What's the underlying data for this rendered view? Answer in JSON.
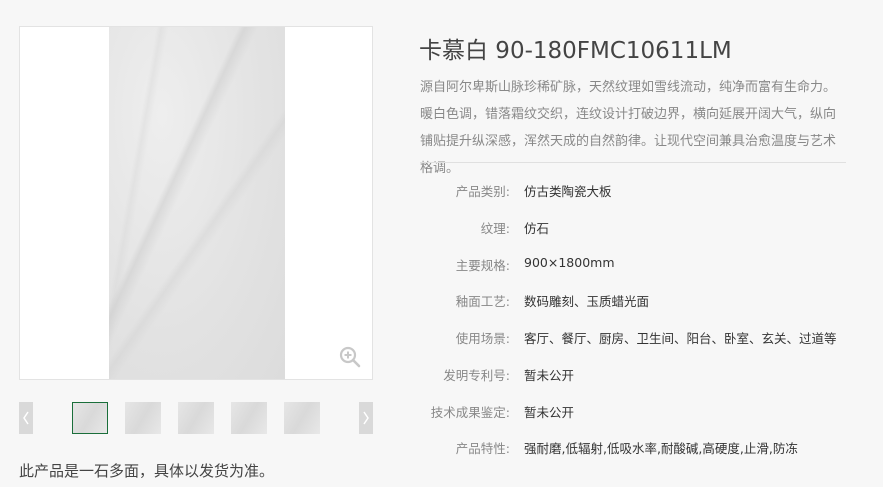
{
  "product": {
    "title": "卡慕白 90-180FMC10611LM",
    "description": "源自阿尔卑斯山脉珍稀矿脉，天然纹理如雪线流动，纯净而富有生命力。暖白色调，错落霜纹交织，连纹设计打破边界，横向延展开阔大气，纵向铺贴提升纵深感，浑然天成的自然韵律。让现代空间兼具治愈温度与艺术格调。"
  },
  "specs": [
    {
      "label": "产品类别:",
      "value": "仿古类陶瓷大板"
    },
    {
      "label": "纹理:",
      "value": "仿石"
    },
    {
      "label": "主要规格:",
      "value": "900×1800mm"
    },
    {
      "label": "釉面工艺:",
      "value": "数码雕刻、玉质蜡光面"
    },
    {
      "label": "使用场景:",
      "value": "客厅、餐厅、厨房、卫生间、阳台、卧室、玄关、过道等"
    },
    {
      "label": "发明专利号:",
      "value": "暂未公开"
    },
    {
      "label": "技术成果鉴定:",
      "value": "暂未公开"
    },
    {
      "label": "产品特性:",
      "value": "强耐磨,低辐射,低吸水率,耐酸碱,高硬度,止滑,防冻"
    }
  ],
  "gallery": {
    "note": "此产品是一石多面，具体以发货为准。",
    "thumbnail_count": 5,
    "active_thumbnail": 0,
    "icons": {
      "zoom": "zoom-in-icon",
      "prev": "chevron-left-icon",
      "next": "chevron-right-icon"
    }
  },
  "colors": {
    "accent": "#1a6e3a",
    "label": "#888888",
    "value": "#333333"
  }
}
